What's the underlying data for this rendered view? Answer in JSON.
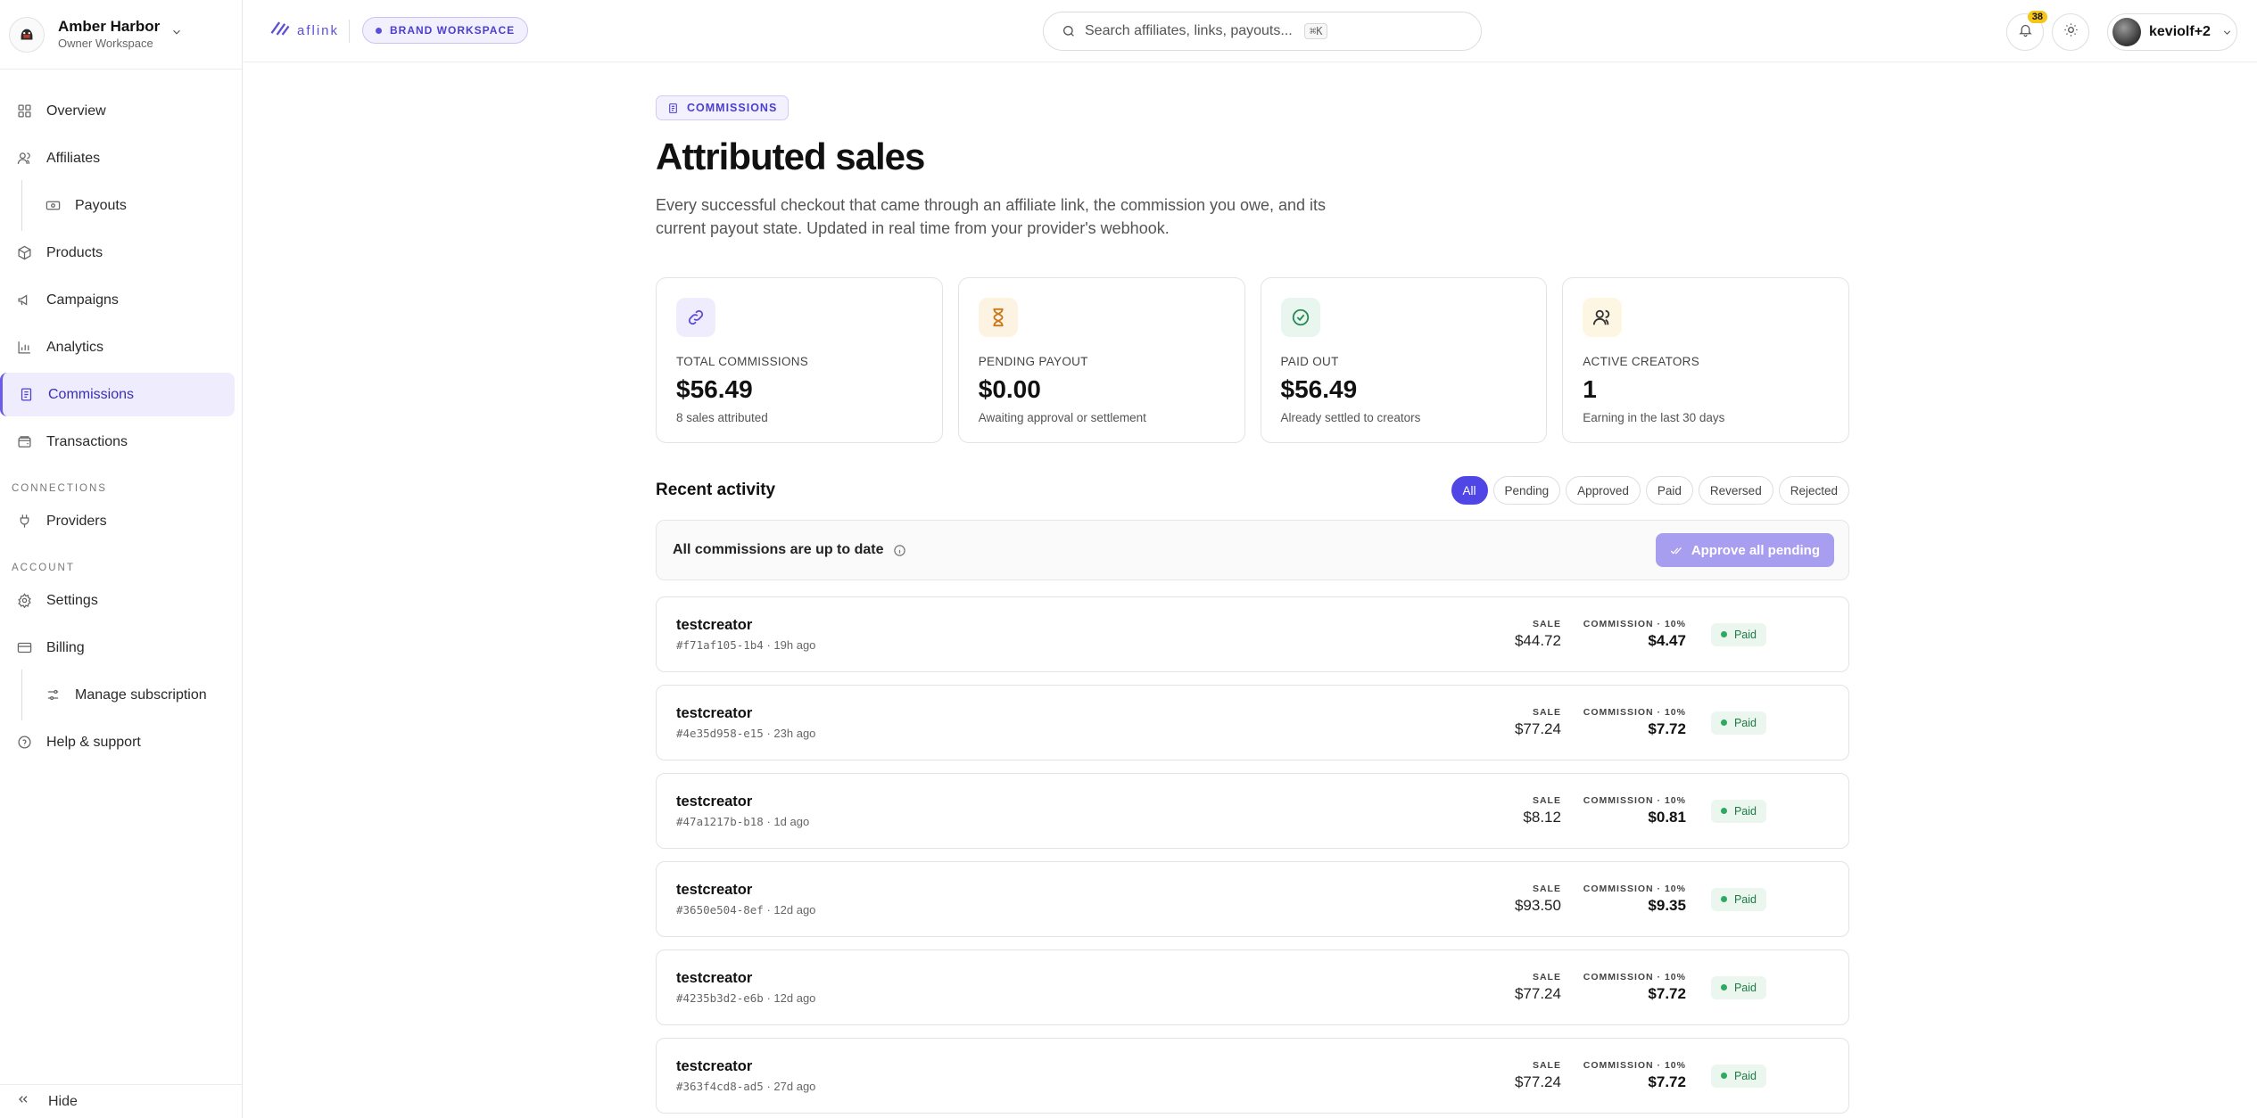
{
  "workspace": {
    "name": "Amber Harbor",
    "role": "Owner Workspace"
  },
  "nav": {
    "items": [
      {
        "label": "Overview",
        "icon": "grid-icon"
      },
      {
        "label": "Affiliates",
        "icon": "users-icon"
      },
      {
        "label": "Payouts",
        "icon": "banknote-icon",
        "sub": true
      },
      {
        "label": "Products",
        "icon": "box-icon"
      },
      {
        "label": "Campaigns",
        "icon": "megaphone-icon"
      },
      {
        "label": "Analytics",
        "icon": "bar-chart-icon"
      },
      {
        "label": "Commissions",
        "icon": "receipt-icon",
        "active": true
      },
      {
        "label": "Transactions",
        "icon": "wallet-icon"
      }
    ],
    "connections_label": "CONNECTIONS",
    "providers": "Providers",
    "account_label": "ACCOUNT",
    "settings": "Settings",
    "billing": "Billing",
    "manage_subscription": "Manage subscription",
    "help": "Help & support",
    "hide": "Hide"
  },
  "topbar": {
    "logo_text": "aflink",
    "brand_pill": "BRAND WORKSPACE",
    "search_placeholder": "Search affiliates, links, payouts...",
    "search_shortcut": "⌘K",
    "notifications_count": "38",
    "user_name": "keviolf+2"
  },
  "page": {
    "crumb": "COMMISSIONS",
    "title": "Attributed sales",
    "description": "Every successful checkout that came through an affiliate link, the commission you owe, and its current payout state. Updated in real time from your provider's webhook."
  },
  "stats": [
    {
      "label": "TOTAL COMMISSIONS",
      "value": "$56.49",
      "sub": "8 sales attributed",
      "icon": "link-icon",
      "bg": "#efedfd",
      "fg": "#5b4fd8"
    },
    {
      "label": "PENDING PAYOUT",
      "value": "$0.00",
      "sub": "Awaiting approval or settlement",
      "icon": "hourglass-icon",
      "bg": "#fdf3e3",
      "fg": "#c9781c"
    },
    {
      "label": "PAID OUT",
      "value": "$56.49",
      "sub": "Already settled to creators",
      "icon": "check-circle-icon",
      "bg": "#e9f6ef",
      "fg": "#2b8a55"
    },
    {
      "label": "ACTIVE CREATORS",
      "value": "1",
      "sub": "Earning in the last 30 days",
      "icon": "users-icon",
      "bg": "#fdf6e3",
      "fg": "#333"
    }
  ],
  "activity": {
    "title": "Recent activity",
    "filters": [
      "All",
      "Pending",
      "Approved",
      "Paid",
      "Reversed",
      "Rejected"
    ],
    "active_filter": "All",
    "notice": "All commissions are up to date",
    "approve_label": "Approve all pending",
    "sale_label": "SALE",
    "commission_label": "COMMISSION · 10%",
    "rows": [
      {
        "creator": "testcreator",
        "id": "#f71af105-1b4",
        "time": "19h ago",
        "sale": "$44.72",
        "commission": "$4.47",
        "status": "Paid"
      },
      {
        "creator": "testcreator",
        "id": "#4e35d958-e15",
        "time": "23h ago",
        "sale": "$77.24",
        "commission": "$7.72",
        "status": "Paid"
      },
      {
        "creator": "testcreator",
        "id": "#47a1217b-b18",
        "time": "1d ago",
        "sale": "$8.12",
        "commission": "$0.81",
        "status": "Paid"
      },
      {
        "creator": "testcreator",
        "id": "#3650e504-8ef",
        "time": "12d ago",
        "sale": "$93.50",
        "commission": "$9.35",
        "status": "Paid"
      },
      {
        "creator": "testcreator",
        "id": "#4235b3d2-e6b",
        "time": "12d ago",
        "sale": "$77.24",
        "commission": "$7.72",
        "status": "Paid"
      },
      {
        "creator": "testcreator",
        "id": "#363f4cd8-ad5",
        "time": "27d ago",
        "sale": "$77.24",
        "commission": "$7.72",
        "status": "Paid"
      }
    ]
  }
}
